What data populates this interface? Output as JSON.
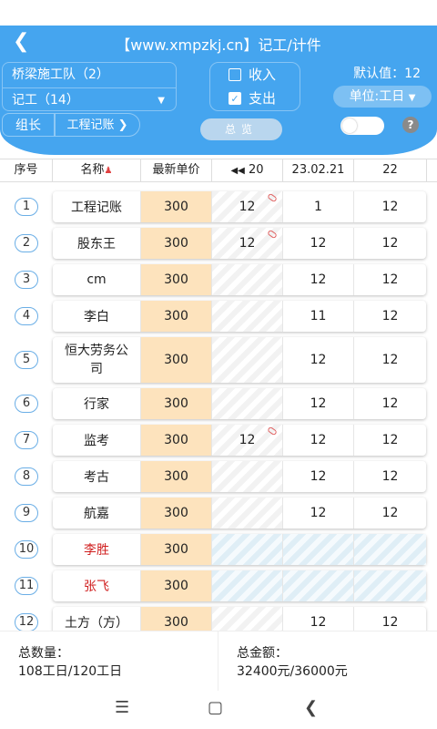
{
  "header": {
    "title": "【www.xmpzkj.cn】记工/计件",
    "team": "桥梁施工队（2）",
    "record_type": "记工（14）",
    "income_label": "收入",
    "expense_label": "支出",
    "default_value": "默认值：12",
    "unit_label": "单位:工日",
    "leader_tab": "组长",
    "ledger_tab": "工程记账",
    "overview_label": "总览",
    "help": "?"
  },
  "table": {
    "headers": [
      "序号",
      "名称",
      "最新单价",
      "20",
      "23.02.21",
      "22"
    ],
    "rows": [
      {
        "no": "1",
        "name": "工程记账",
        "price": "300",
        "a": "12",
        "b": "1",
        "c": "12"
      },
      {
        "no": "2",
        "name": "股东王",
        "price": "300",
        "a": "12",
        "b": "12",
        "c": "12"
      },
      {
        "no": "3",
        "name": "cm",
        "price": "300",
        "a": "",
        "b": "12",
        "c": "12"
      },
      {
        "no": "4",
        "name": "李白",
        "price": "300",
        "a": "",
        "b": "11",
        "c": "12"
      },
      {
        "no": "5",
        "name": "恒大劳务公司",
        "price": "300",
        "a": "",
        "b": "12",
        "c": "12"
      },
      {
        "no": "6",
        "name": "行家",
        "price": "300",
        "a": "",
        "b": "12",
        "c": "12"
      },
      {
        "no": "7",
        "name": "监考",
        "price": "300",
        "a": "12",
        "b": "12",
        "c": "12"
      },
      {
        "no": "8",
        "name": "考古",
        "price": "300",
        "a": "",
        "b": "12",
        "c": "12"
      },
      {
        "no": "9",
        "name": "航嘉",
        "price": "300",
        "a": "",
        "b": "12",
        "c": "12"
      },
      {
        "no": "10",
        "name": "李胜",
        "price": "300",
        "a": "",
        "b": "",
        "c": ""
      },
      {
        "no": "11",
        "name": "张飞",
        "price": "300",
        "a": "",
        "b": "",
        "c": ""
      },
      {
        "no": "12",
        "name": "土方（方）",
        "price": "300",
        "a": "",
        "b": "12",
        "c": "12"
      }
    ]
  },
  "footer": {
    "qty_label": "总数量：",
    "qty_value": "108工日/120工日",
    "amount_label": "总金额：",
    "amount_value": "32400元/36000元"
  },
  "colors": {
    "brand": "#45a5ef",
    "price_bg": "#fde3bd",
    "alert_red": "#d02020"
  }
}
